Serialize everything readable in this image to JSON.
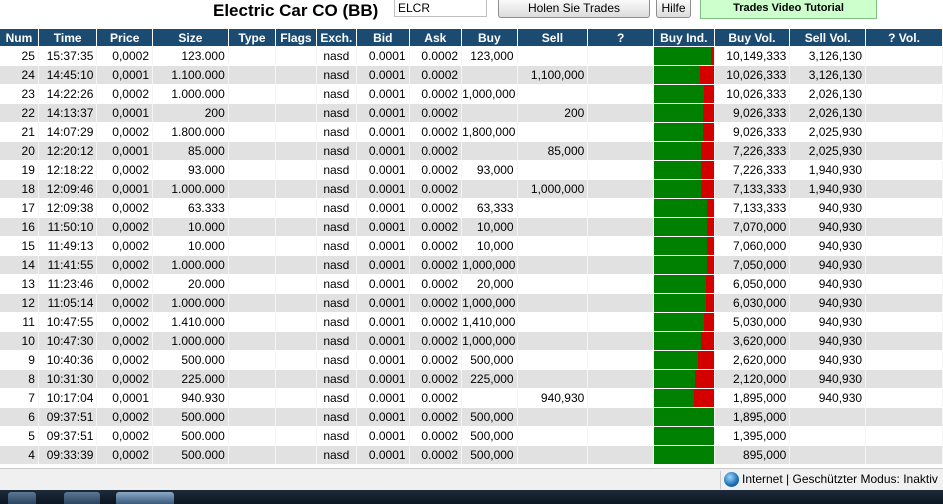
{
  "header": {
    "title": "Electric Car CO (BB)",
    "symbol_value": "ELCR",
    "get_trades_label": "Holen Sie Trades",
    "help_label": "Hilfe",
    "video_label": "Trades Video Tutorial"
  },
  "columns": [
    "Num",
    "Time",
    "Price",
    "Size",
    "Type",
    "Flags",
    "Exch.",
    "Bid",
    "Ask",
    "Buy",
    "Sell",
    "? ",
    "Buy Ind.",
    "Buy Vol.",
    "Sell Vol.",
    "? Vol."
  ],
  "rows": [
    {
      "num": "25",
      "time": "15:37:35",
      "price": "0,0002",
      "size": "123.000",
      "type": "",
      "flags": "",
      "exch": "nasd",
      "bid": "0.0001",
      "ask": "0.0002",
      "buy": "123,000",
      "sell": "",
      "q": "",
      "buy_ind": 0.95,
      "buy_vol": "10,149,333",
      "sell_vol": "3,126,130",
      "q_vol": ""
    },
    {
      "num": "24",
      "time": "14:45:10",
      "price": "0,0001",
      "size": "1.100.000",
      "type": "",
      "flags": "",
      "exch": "nasd",
      "bid": "0.0001",
      "ask": "0.0002",
      "buy": "",
      "sell": "1,100,000",
      "q": "",
      "buy_ind": 0.76,
      "buy_vol": "10,026,333",
      "sell_vol": "3,126,130",
      "q_vol": ""
    },
    {
      "num": "23",
      "time": "14:22:26",
      "price": "0,0002",
      "size": "1.000.000",
      "type": "",
      "flags": "",
      "exch": "nasd",
      "bid": "0.0001",
      "ask": "0.0002",
      "buy": "1,000,000",
      "sell": "",
      "q": "",
      "buy_ind": 0.83,
      "buy_vol": "10,026,333",
      "sell_vol": "2,026,130",
      "q_vol": ""
    },
    {
      "num": "22",
      "time": "14:13:37",
      "price": "0,0001",
      "size": "200",
      "type": "",
      "flags": "",
      "exch": "nasd",
      "bid": "0.0001",
      "ask": "0.0002",
      "buy": "",
      "sell": "200",
      "q": "",
      "buy_ind": 0.82,
      "buy_vol": "9,026,333",
      "sell_vol": "2,026,130",
      "q_vol": ""
    },
    {
      "num": "21",
      "time": "14:07:29",
      "price": "0,0002",
      "size": "1.800.000",
      "type": "",
      "flags": "",
      "exch": "nasd",
      "bid": "0.0001",
      "ask": "0.0002",
      "buy": "1,800,000",
      "sell": "",
      "q": "",
      "buy_ind": 0.82,
      "buy_vol": "9,026,333",
      "sell_vol": "2,025,930",
      "q_vol": ""
    },
    {
      "num": "20",
      "time": "12:20:12",
      "price": "0,0001",
      "size": "85.000",
      "type": "",
      "flags": "",
      "exch": "nasd",
      "bid": "0.0001",
      "ask": "0.0002",
      "buy": "",
      "sell": "85,000",
      "q": "",
      "buy_ind": 0.78,
      "buy_vol": "7,226,333",
      "sell_vol": "2,025,930",
      "q_vol": ""
    },
    {
      "num": "19",
      "time": "12:18:22",
      "price": "0,0002",
      "size": "93.000",
      "type": "",
      "flags": "",
      "exch": "nasd",
      "bid": "0.0001",
      "ask": "0.0002",
      "buy": "93,000",
      "sell": "",
      "q": "",
      "buy_ind": 0.79,
      "buy_vol": "7,226,333",
      "sell_vol": "1,940,930",
      "q_vol": ""
    },
    {
      "num": "18",
      "time": "12:09:46",
      "price": "0,0001",
      "size": "1.000.000",
      "type": "",
      "flags": "",
      "exch": "nasd",
      "bid": "0.0001",
      "ask": "0.0002",
      "buy": "",
      "sell": "1,000,000",
      "q": "",
      "buy_ind": 0.79,
      "buy_vol": "7,133,333",
      "sell_vol": "1,940,930",
      "q_vol": ""
    },
    {
      "num": "17",
      "time": "12:09:38",
      "price": "0,0002",
      "size": "63.333",
      "type": "",
      "flags": "",
      "exch": "nasd",
      "bid": "0.0001",
      "ask": "0.0002",
      "buy": "63,333",
      "sell": "",
      "q": "",
      "buy_ind": 0.88,
      "buy_vol": "7,133,333",
      "sell_vol": "940,930",
      "q_vol": ""
    },
    {
      "num": "16",
      "time": "11:50:10",
      "price": "0,0002",
      "size": "10.000",
      "type": "",
      "flags": "",
      "exch": "nasd",
      "bid": "0.0001",
      "ask": "0.0002",
      "buy": "10,000",
      "sell": "",
      "q": "",
      "buy_ind": 0.88,
      "buy_vol": "7,070,000",
      "sell_vol": "940,930",
      "q_vol": ""
    },
    {
      "num": "15",
      "time": "11:49:13",
      "price": "0,0002",
      "size": "10.000",
      "type": "",
      "flags": "",
      "exch": "nasd",
      "bid": "0.0001",
      "ask": "0.0002",
      "buy": "10,000",
      "sell": "",
      "q": "",
      "buy_ind": 0.88,
      "buy_vol": "7,060,000",
      "sell_vol": "940,930",
      "q_vol": ""
    },
    {
      "num": "14",
      "time": "11:41:55",
      "price": "0,0002",
      "size": "1.000.000",
      "type": "",
      "flags": "",
      "exch": "nasd",
      "bid": "0.0001",
      "ask": "0.0002",
      "buy": "1,000,000",
      "sell": "",
      "q": "",
      "buy_ind": 0.88,
      "buy_vol": "7,050,000",
      "sell_vol": "940,930",
      "q_vol": ""
    },
    {
      "num": "13",
      "time": "11:23:46",
      "price": "0,0002",
      "size": "20.000",
      "type": "",
      "flags": "",
      "exch": "nasd",
      "bid": "0.0001",
      "ask": "0.0002",
      "buy": "20,000",
      "sell": "",
      "q": "",
      "buy_ind": 0.87,
      "buy_vol": "6,050,000",
      "sell_vol": "940,930",
      "q_vol": ""
    },
    {
      "num": "12",
      "time": "11:05:14",
      "price": "0,0002",
      "size": "1.000.000",
      "type": "",
      "flags": "",
      "exch": "nasd",
      "bid": "0.0001",
      "ask": "0.0002",
      "buy": "1,000,000",
      "sell": "",
      "q": "",
      "buy_ind": 0.87,
      "buy_vol": "6,030,000",
      "sell_vol": "940,930",
      "q_vol": ""
    },
    {
      "num": "11",
      "time": "10:47:55",
      "price": "0,0002",
      "size": "1.410.000",
      "type": "",
      "flags": "",
      "exch": "nasd",
      "bid": "0.0001",
      "ask": "0.0002",
      "buy": "1,410,000",
      "sell": "",
      "q": "",
      "buy_ind": 0.84,
      "buy_vol": "5,030,000",
      "sell_vol": "940,930",
      "q_vol": ""
    },
    {
      "num": "10",
      "time": "10:47:30",
      "price": "0,0002",
      "size": "1.000.000",
      "type": "",
      "flags": "",
      "exch": "nasd",
      "bid": "0.0001",
      "ask": "0.0002",
      "buy": "1,000,000",
      "sell": "",
      "q": "",
      "buy_ind": 0.79,
      "buy_vol": "3,620,000",
      "sell_vol": "940,930",
      "q_vol": ""
    },
    {
      "num": "9",
      "time": "10:40:36",
      "price": "0,0002",
      "size": "500.000",
      "type": "",
      "flags": "",
      "exch": "nasd",
      "bid": "0.0001",
      "ask": "0.0002",
      "buy": "500,000",
      "sell": "",
      "q": "",
      "buy_ind": 0.74,
      "buy_vol": "2,620,000",
      "sell_vol": "940,930",
      "q_vol": ""
    },
    {
      "num": "8",
      "time": "10:31:30",
      "price": "0,0002",
      "size": "225.000",
      "type": "",
      "flags": "",
      "exch": "nasd",
      "bid": "0.0001",
      "ask": "0.0002",
      "buy": "225,000",
      "sell": "",
      "q": "",
      "buy_ind": 0.69,
      "buy_vol": "2,120,000",
      "sell_vol": "940,930",
      "q_vol": ""
    },
    {
      "num": "7",
      "time": "10:17:04",
      "price": "0,0001",
      "size": "940.930",
      "type": "",
      "flags": "",
      "exch": "nasd",
      "bid": "0.0001",
      "ask": "0.0002",
      "buy": "",
      "sell": "940,930",
      "q": "",
      "buy_ind": 0.67,
      "buy_vol": "1,895,000",
      "sell_vol": "940,930",
      "q_vol": ""
    },
    {
      "num": "6",
      "time": "09:37:51",
      "price": "0,0002",
      "size": "500.000",
      "type": "",
      "flags": "",
      "exch": "nasd",
      "bid": "0.0001",
      "ask": "0.0002",
      "buy": "500,000",
      "sell": "",
      "q": "",
      "buy_ind": 1.0,
      "buy_vol": "1,895,000",
      "sell_vol": "",
      "q_vol": ""
    },
    {
      "num": "5",
      "time": "09:37:51",
      "price": "0,0002",
      "size": "500.000",
      "type": "",
      "flags": "",
      "exch": "nasd",
      "bid": "0.0001",
      "ask": "0.0002",
      "buy": "500,000",
      "sell": "",
      "q": "",
      "buy_ind": 1.0,
      "buy_vol": "1,395,000",
      "sell_vol": "",
      "q_vol": ""
    },
    {
      "num": "4",
      "time": "09:33:39",
      "price": "0,0002",
      "size": "500.000",
      "type": "",
      "flags": "",
      "exch": "nasd",
      "bid": "0.0001",
      "ask": "0.0002",
      "buy": "500,000",
      "sell": "",
      "q": "",
      "buy_ind": 1.0,
      "buy_vol": "895,000",
      "sell_vol": "",
      "q_vol": ""
    }
  ],
  "status": {
    "text": "Internet | Geschützter Modus: Inaktiv"
  },
  "colors": {
    "header_bg": "#1c4b72",
    "buy_ind_green": "#008000",
    "buy_ind_red": "#d40000",
    "video_button_bg": "#ccffcc"
  },
  "icons": [
    "globe-icon"
  ]
}
